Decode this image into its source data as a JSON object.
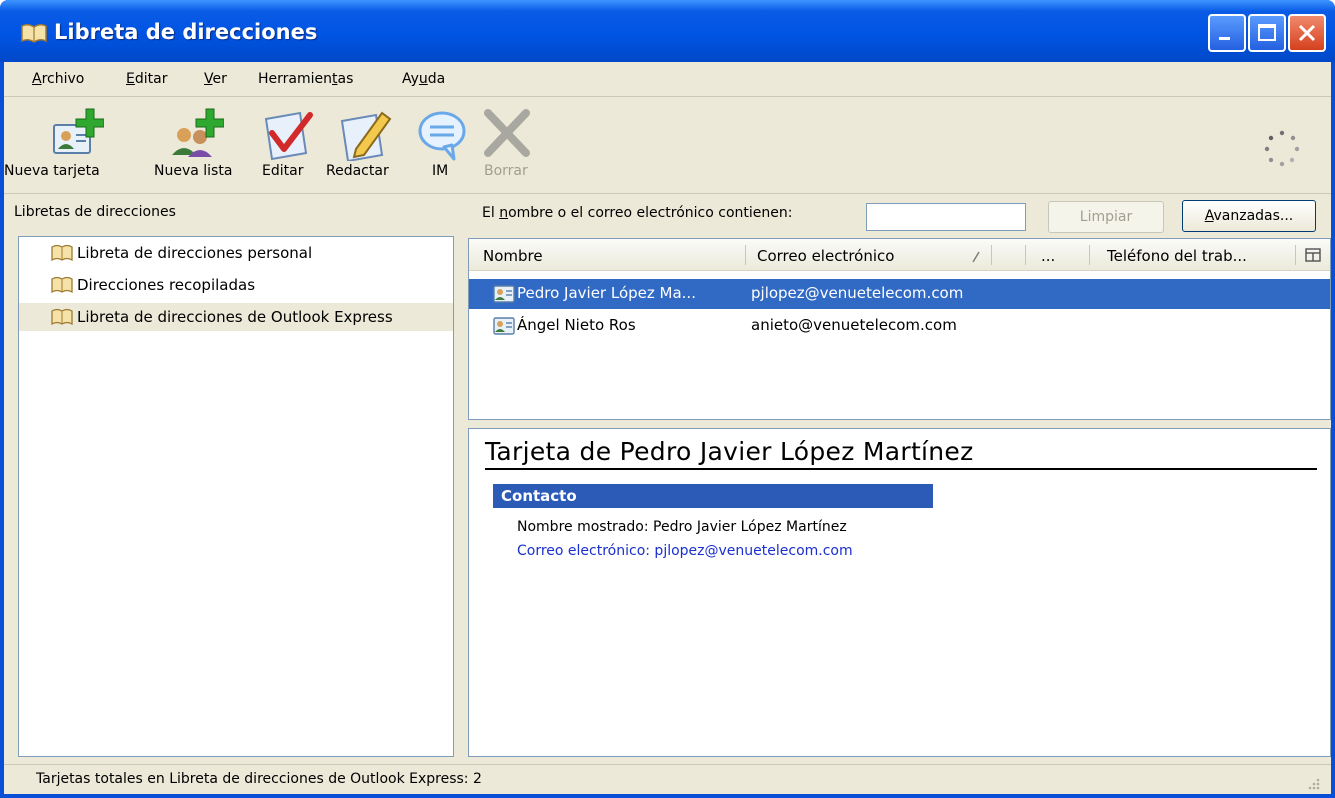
{
  "window": {
    "title": "Libreta de direcciones",
    "title_color": "#0054e3"
  },
  "menu": {
    "items": [
      {
        "pre": "",
        "key": "A",
        "post": "rchivo"
      },
      {
        "pre": "",
        "key": "E",
        "post": "ditar"
      },
      {
        "pre": "",
        "key": "V",
        "post": "er"
      },
      {
        "pre": "Herramien",
        "key": "t",
        "post": "as"
      },
      {
        "pre": "Ay",
        "key": "u",
        "post": "da"
      }
    ]
  },
  "toolbar": {
    "new_card": "Nueva tarjeta",
    "new_list": "Nueva lista",
    "edit": "Editar",
    "compose": "Redactar",
    "im": "IM",
    "delete": "Borrar"
  },
  "sidebar": {
    "heading": "Libretas de direcciones",
    "items": [
      {
        "label": "Libreta de direcciones personal",
        "selected": false
      },
      {
        "label": "Direcciones recopiladas",
        "selected": false
      },
      {
        "label": "Libreta de direcciones de Outlook Express",
        "selected": true
      }
    ]
  },
  "search": {
    "label_pre": "El ",
    "label_key": "n",
    "label_post": "ombre o el correo electrónico contienen:",
    "value": "",
    "clear_label": "Limpiar",
    "advanced_pre": "",
    "advanced_key": "A",
    "advanced_post": "vanzadas..."
  },
  "table": {
    "columns": [
      "Nombre",
      "Correo electrónico",
      "...",
      "Teléfono del trab..."
    ],
    "rows": [
      {
        "name": "Pedro Javier López Ma...",
        "email": "pjlopez@venuetelecom.com",
        "selected": true
      },
      {
        "name": "Ángel Nieto Ros",
        "email": "anieto@venuetelecom.com",
        "selected": false
      }
    ]
  },
  "card": {
    "title": "Tarjeta de Pedro Javier López Martínez",
    "section": "Contacto",
    "display_name": "Nombre mostrado: Pedro Javier López Martínez",
    "email": "Correo electrónico: pjlopez@venuetelecom.com",
    "link_color": "#1a2fd0",
    "section_color": "#2b5bb7"
  },
  "status": {
    "text": "Tarjetas totales en Libreta de direcciones de Outlook Express: 2"
  }
}
